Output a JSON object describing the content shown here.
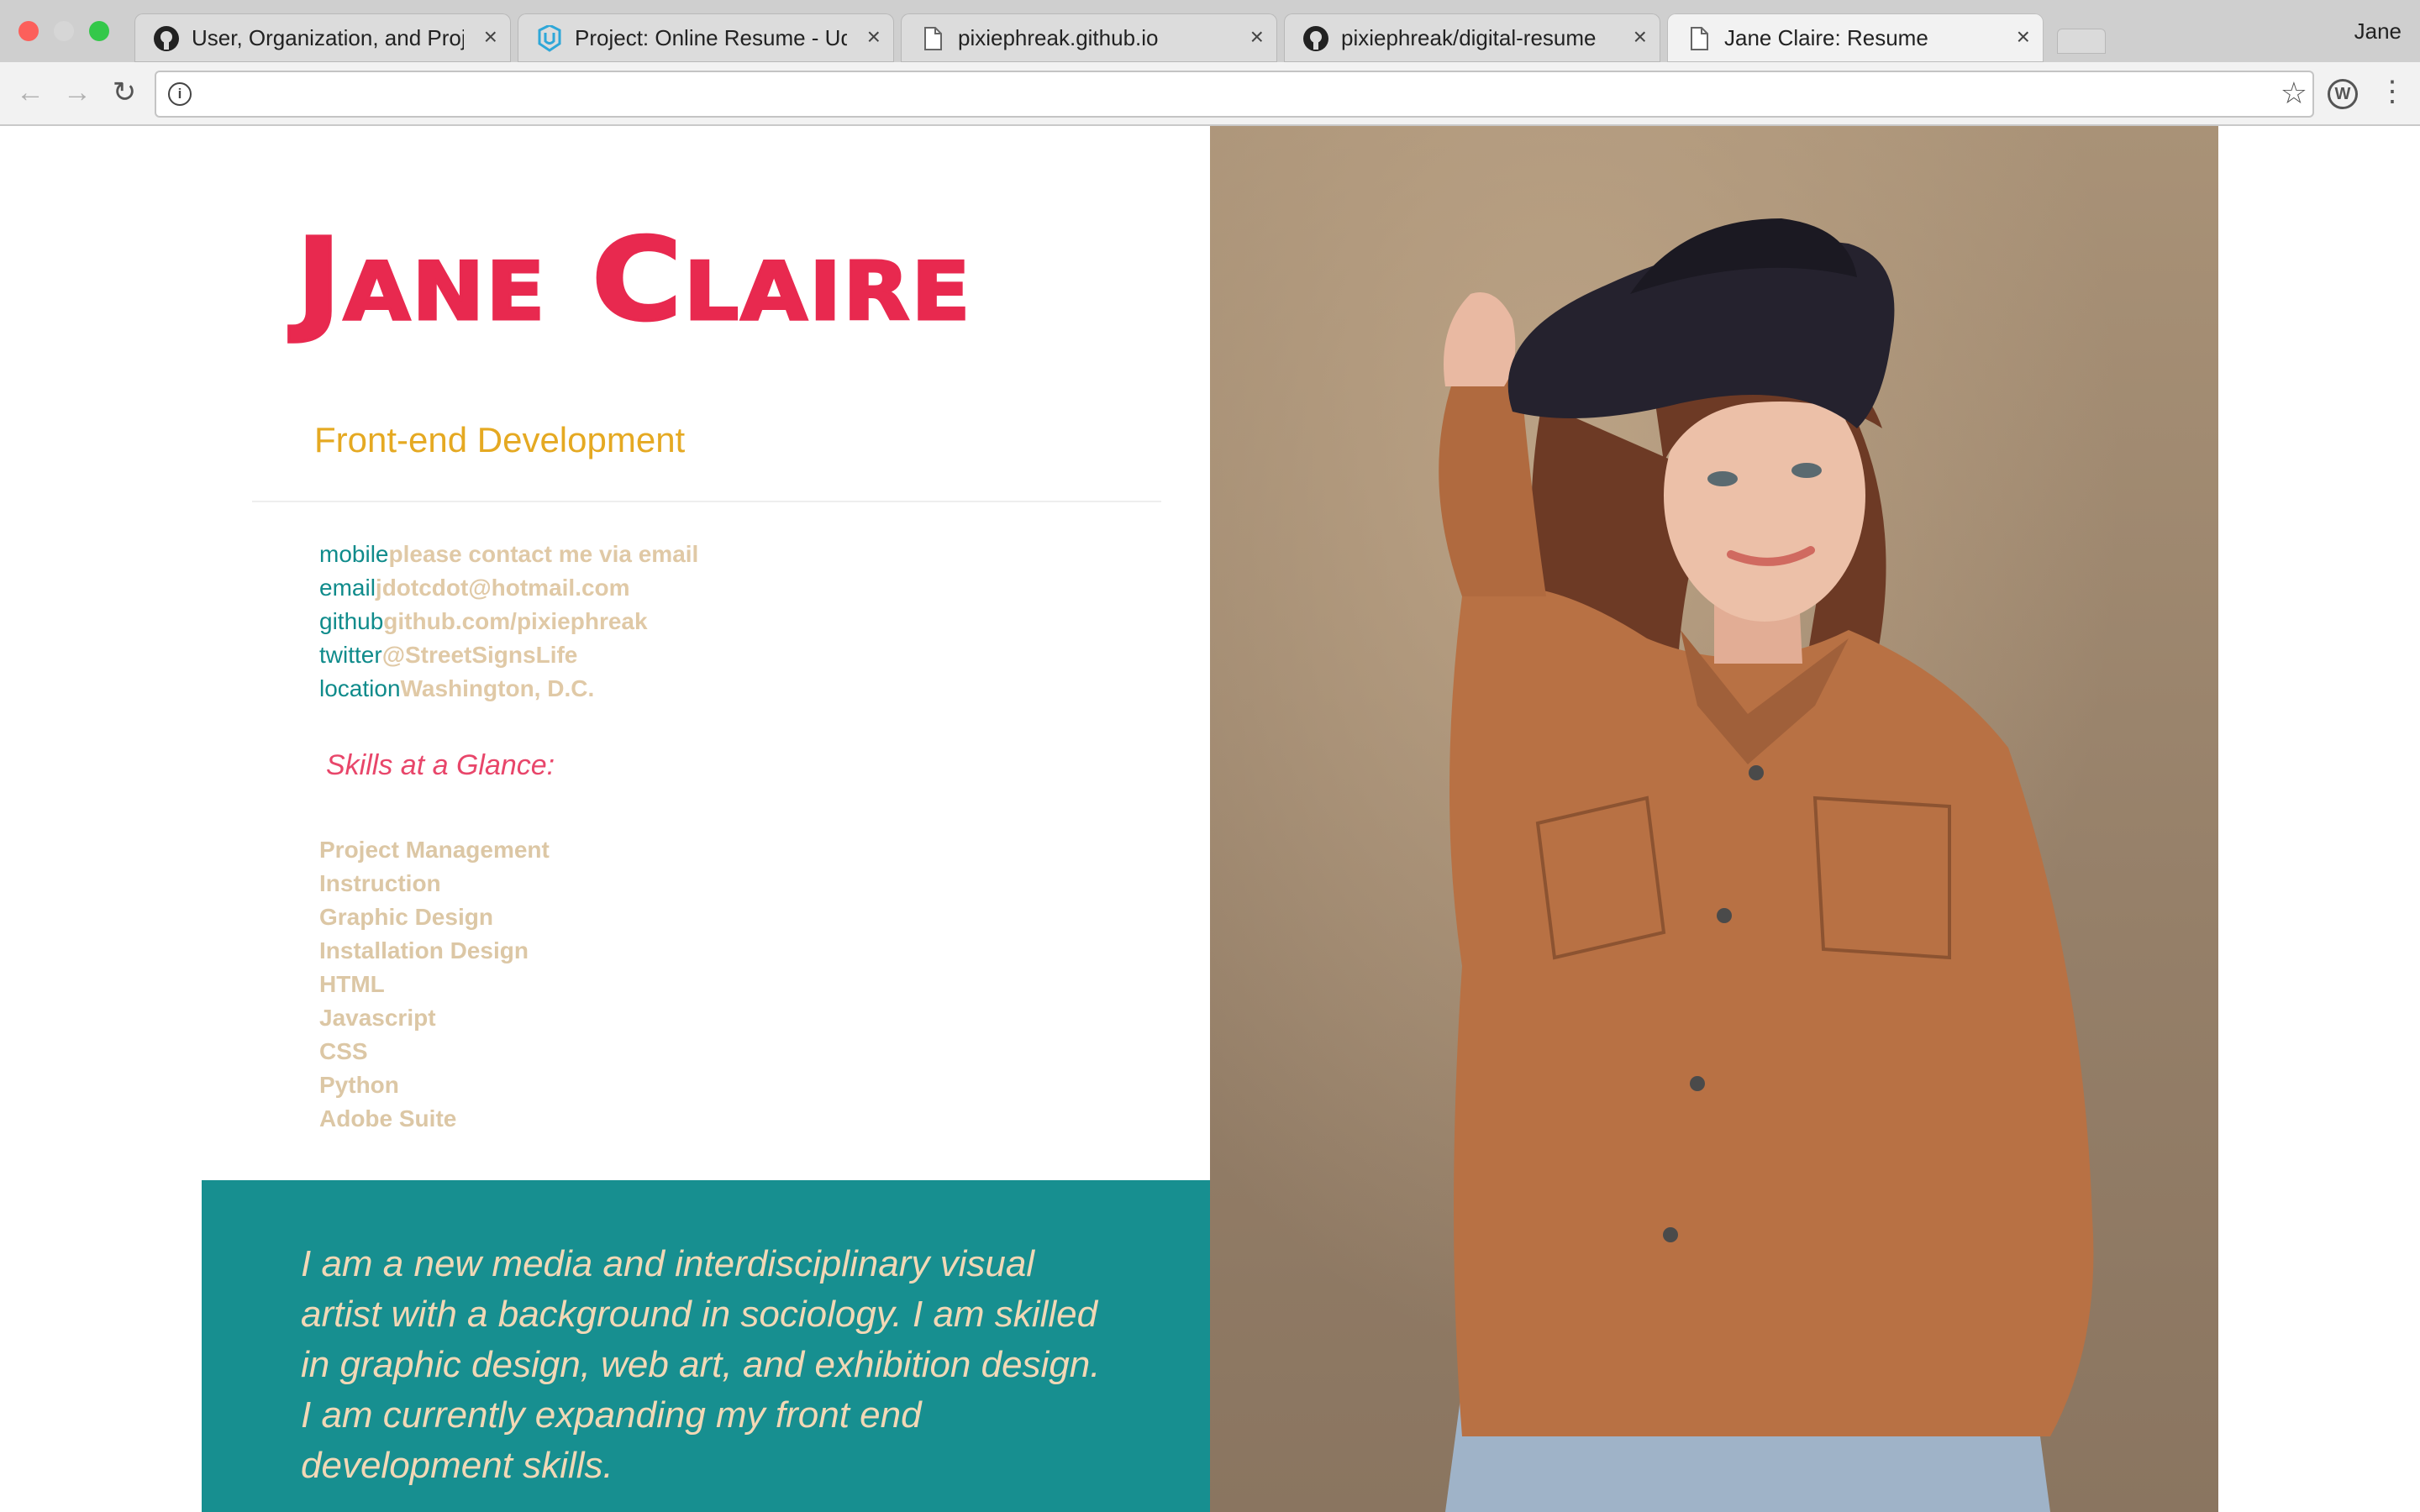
{
  "browser": {
    "tabs": [
      {
        "title": "User, Organization, and Projec",
        "icon": "github-icon",
        "active": false
      },
      {
        "title": "Project: Online Resume - Udac",
        "icon": "udacity-icon",
        "active": false
      },
      {
        "title": "pixiephreak.github.io",
        "icon": "page-icon",
        "active": false
      },
      {
        "title": "pixiephreak/digital-resume",
        "icon": "github-icon",
        "active": false
      },
      {
        "title": "Jane Claire: Resume",
        "icon": "page-icon",
        "active": true
      }
    ],
    "profile_name": "Jane",
    "url": "",
    "colors": {
      "close": "#fc605b",
      "minimize": "#d6d6d6",
      "maximize": "#34c84a"
    }
  },
  "resume": {
    "name": "Jane Claire",
    "role": "Front-end Development",
    "contacts": [
      {
        "label": "mobile",
        "value": "please contact me via email"
      },
      {
        "label": "email",
        "value": "jdotcdot@hotmail.com"
      },
      {
        "label": "github",
        "value": "github.com/pixiephreak"
      },
      {
        "label": "twitter",
        "value": "@StreetSignsLife"
      },
      {
        "label": "location",
        "value": "Washington, D.C."
      }
    ],
    "skills_heading": "Skills at a Glance:",
    "skills": [
      "Project Management",
      "Instruction",
      "Graphic Design",
      "Installation Design",
      "HTML",
      "Javascript",
      "CSS",
      "Python",
      "Adobe Suite"
    ],
    "bio": "I am a new media and interdisciplinary visual artist with a background in sociology. I am skilled in graphic design, web art, and exhibition design. I am currently expanding my front end development skills.",
    "colors": {
      "name": "#e8294f",
      "role": "#e5a922",
      "contact_label": "#0f8b8b",
      "contact_value": "#e0c9a6",
      "skills_heading": "#e8466a",
      "bio_background": "#178f90",
      "bio_text": "#f1d8b6"
    }
  }
}
